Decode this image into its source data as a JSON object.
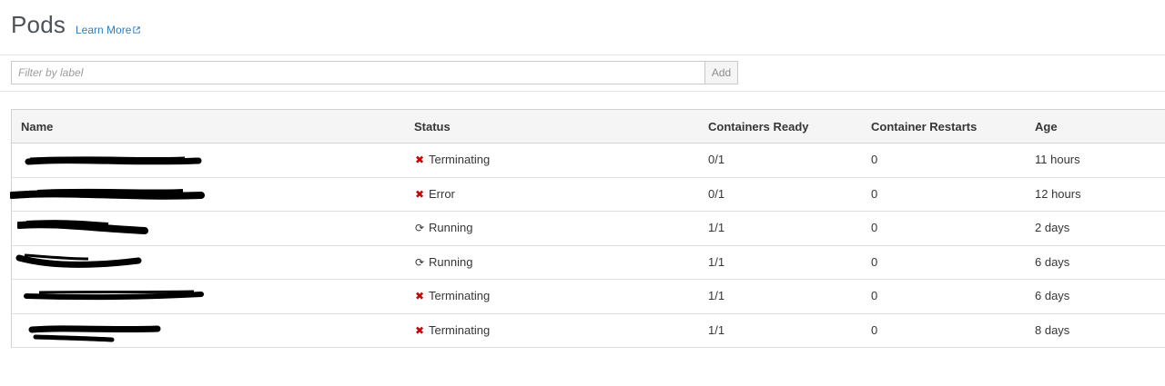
{
  "header": {
    "title": "Pods",
    "learn_more": "Learn More"
  },
  "filter": {
    "placeholder": "Filter by label",
    "add_label": "Add"
  },
  "table": {
    "columns": [
      "Name",
      "Status",
      "Containers Ready",
      "Container Restarts",
      "Age"
    ],
    "rows": [
      {
        "name": "",
        "status": "Terminating",
        "status_icon": "x-icon",
        "ready": "0/1",
        "restarts": "0",
        "age": "11 hours"
      },
      {
        "name": "",
        "status": "Error",
        "status_icon": "x-icon",
        "ready": "0/1",
        "restarts": "0",
        "age": "12 hours"
      },
      {
        "name": "",
        "status": "Running",
        "status_icon": "sync-icon",
        "ready": "1/1",
        "restarts": "0",
        "age": "2 days"
      },
      {
        "name": "",
        "status": "Running",
        "status_icon": "sync-icon",
        "ready": "1/1",
        "restarts": "0",
        "age": "6 days"
      },
      {
        "name": "",
        "status": "Terminating",
        "status_icon": "x-icon",
        "ready": "1/1",
        "restarts": "0",
        "age": "6 days"
      },
      {
        "name": "",
        "status": "Terminating",
        "status_icon": "x-icon",
        "ready": "1/1",
        "restarts": "0",
        "age": "8 days"
      }
    ]
  },
  "colors": {
    "link": "#2e7dbf",
    "error_icon": "#cc0000",
    "header_bg": "#f5f5f5"
  }
}
